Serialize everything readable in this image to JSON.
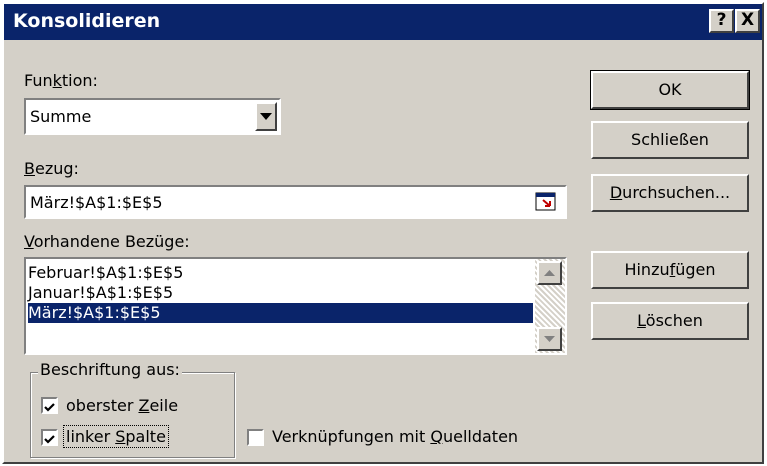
{
  "dialog": {
    "title": "Konsolidieren",
    "help_label": "?",
    "close_label": "X"
  },
  "funktion": {
    "label_pre": "Fun",
    "label_ul": "k",
    "label_post": "tion:",
    "selected": "Summe"
  },
  "bezug": {
    "label_ul": "B",
    "label_post": "ezug:",
    "value": "März!$A$1:$E$5"
  },
  "vorhandene": {
    "label_ul": "V",
    "label_post": "orhandene Bezüge:",
    "items": [
      "Februar!$A$1:$E$5",
      "Januar!$A$1:$E$5",
      "März!$A$1:$E$5"
    ],
    "selected_index": 2
  },
  "beschriftung": {
    "legend": "Beschriftung aus:",
    "top_row_pre": "oberster ",
    "top_row_ul": "Z",
    "top_row_post": "eile",
    "top_row_checked": true,
    "left_col_pre": "linker ",
    "left_col_ul": "S",
    "left_col_post": "palte",
    "left_col_checked": true
  },
  "links": {
    "pre": "Verknüpfungen mit ",
    "ul": "Q",
    "post": "uelldaten",
    "checked": false
  },
  "buttons": {
    "ok": "OK",
    "close": "Schließen",
    "browse_ul": "D",
    "browse_post": "urchsuchen...",
    "add_pre": "Hinzu",
    "add_ul": "f",
    "add_post": "ügen",
    "delete_ul": "L",
    "delete_post": "öschen"
  },
  "colors": {
    "titlebar": "#0a246a",
    "face": "#d4d0c8",
    "selection": "#0a246a"
  }
}
